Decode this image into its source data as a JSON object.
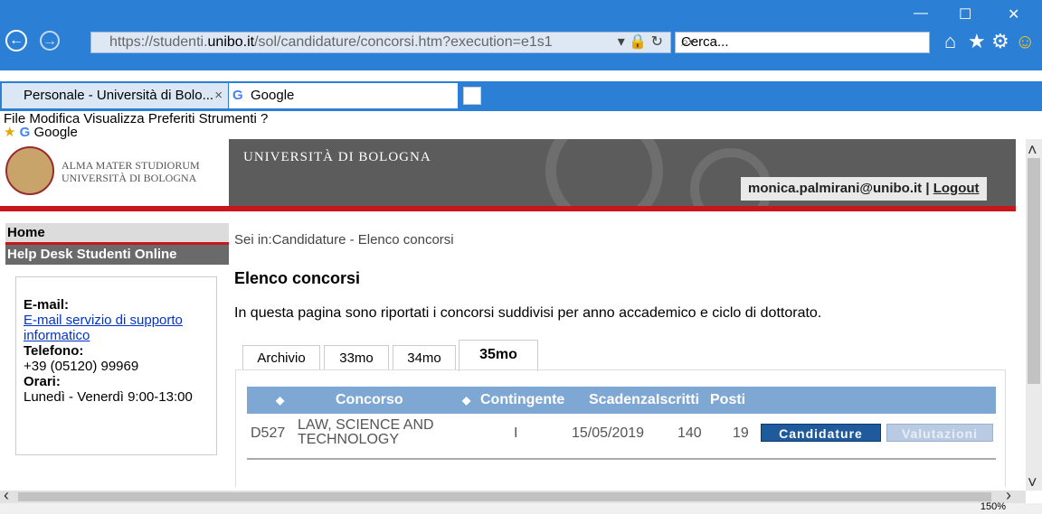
{
  "browser": {
    "url_prefix": "https://studenti.",
    "url_domain": "unibo.it",
    "url_path": "/sol/candidature/concorsi.htm?execution=e1s1",
    "address_controls": "▾ 🔒 ↻",
    "search_placeholder": "Cerca...",
    "tabs": [
      {
        "label": "Personale - Università di Bolo...",
        "close": "×"
      },
      {
        "label": "Google"
      }
    ],
    "menu": [
      "File",
      "Modifica",
      "Visualizza",
      "Preferiti",
      "Strumenti",
      "?"
    ],
    "favorites": [
      "Google"
    ],
    "zoom": "150%"
  },
  "site": {
    "logo_line1": "ALMA MATER STUDIORUM",
    "logo_line2": "UNIVERSITÀ DI BOLOGNA",
    "banner_title": "UNIVERSITÀ DI BOLOGNA",
    "user": "monica.palmirani@unibo.it",
    "separator": "|",
    "logout": "Logout"
  },
  "sidebar": {
    "home": "Home",
    "help": "Help Desk Studenti Online",
    "email_label": "E-mail:",
    "email_link": "E-mail servizio di supporto informatico",
    "phone_label": "Telefono:",
    "phone": "+39 (05120) 99969",
    "hours_label": "Orari:",
    "hours": "Lunedì - Venerdì 9:00-13:00"
  },
  "main": {
    "breadcrumb": "Sei in:Candidature - Elenco concorsi",
    "title": "Elenco concorsi",
    "intro": "In questa pagina sono riportati i concorsi suddivisi per anno accademico e ciclo di dottorato.",
    "tabs": [
      "Archivio",
      "33mo",
      "34mo",
      "35mo"
    ],
    "columns": {
      "sort": "◆",
      "concorso": "Concorso",
      "contingente": "Contingente",
      "scadenza": "Scadenza",
      "iscritti": "Iscritti",
      "posti": "Posti"
    },
    "row": {
      "code": "D527",
      "name_line1": "LAW, SCIENCE AND",
      "name_line2": "TECHNOLOGY",
      "contingente": "I",
      "scadenza": "15/05/2019",
      "iscritti": "140",
      "posti": "19",
      "btn_candidature": "Candidature",
      "btn_valutazioni": "Valutazioni"
    }
  }
}
